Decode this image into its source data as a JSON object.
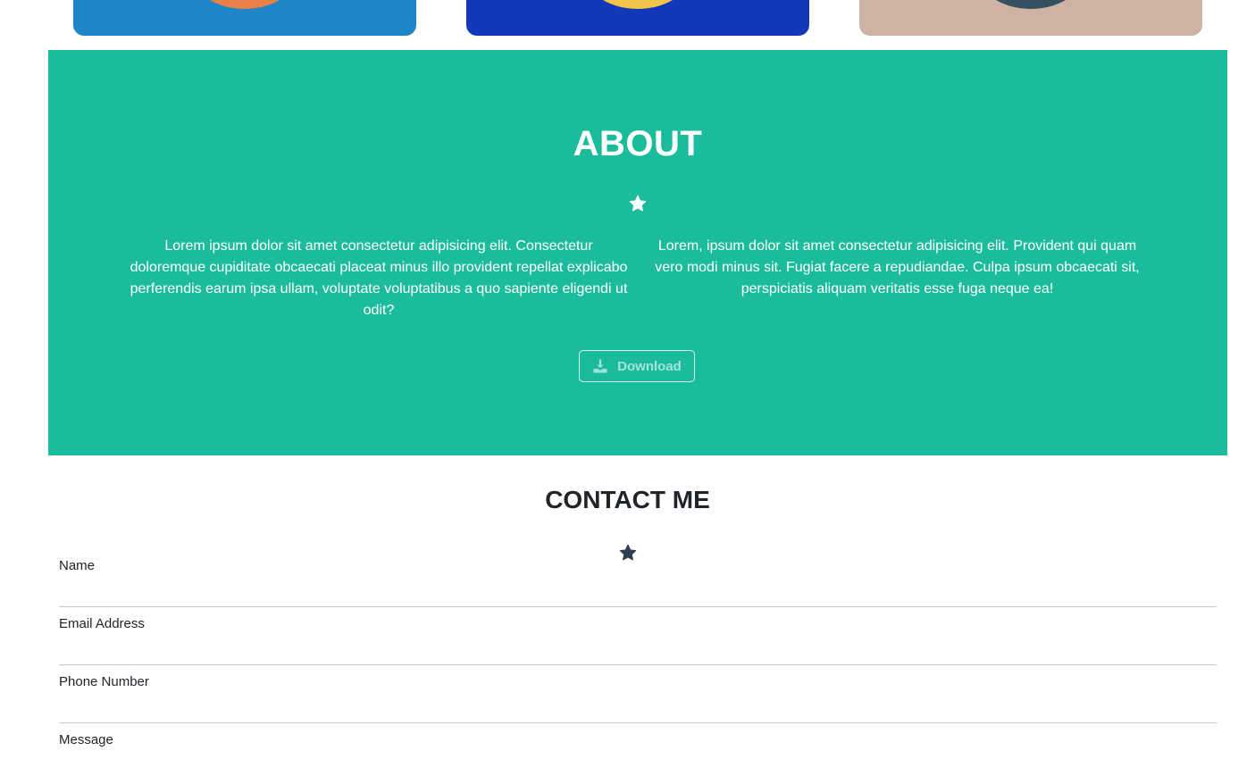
{
  "portfolio_cards": [
    {
      "name": "card-1",
      "background": "#1e86c6",
      "disc_color": "#e9804a"
    },
    {
      "name": "card-2",
      "background": "#1237b8",
      "disc_color": "#f1c54a"
    },
    {
      "name": "card-3",
      "background": "#ceb2a3",
      "disc_color": "#35505f"
    }
  ],
  "about": {
    "title": "ABOUT",
    "icon": "star-icon",
    "background": "#1abc9c",
    "paragraph_left": "Lorem ipsum dolor sit amet consectetur adipisicing elit. Consectetur doloremque cupiditate obcaecati placeat minus illo provident repellat explicabo perferendis earum ipsa ullam, voluptate voluptatibus a quo sapiente eligendi ut odit?",
    "paragraph_right": "Lorem, ipsum dolor sit amet consectetur adipisicing elit. Provident qui quam vero modi minus sit. Fugiat facere a repudiandae. Culpa ipsum obcaecati sit, perspiciatis aliquam veritatis esse fuga neque ea!",
    "download_label": "Download",
    "download_icon": "download-icon"
  },
  "contact": {
    "title": "CONTACT ME",
    "icon": "star-icon",
    "fields": {
      "name_label": "Name",
      "email_label": "Email Address",
      "phone_label": "Phone Number",
      "message_label": "Message"
    }
  }
}
